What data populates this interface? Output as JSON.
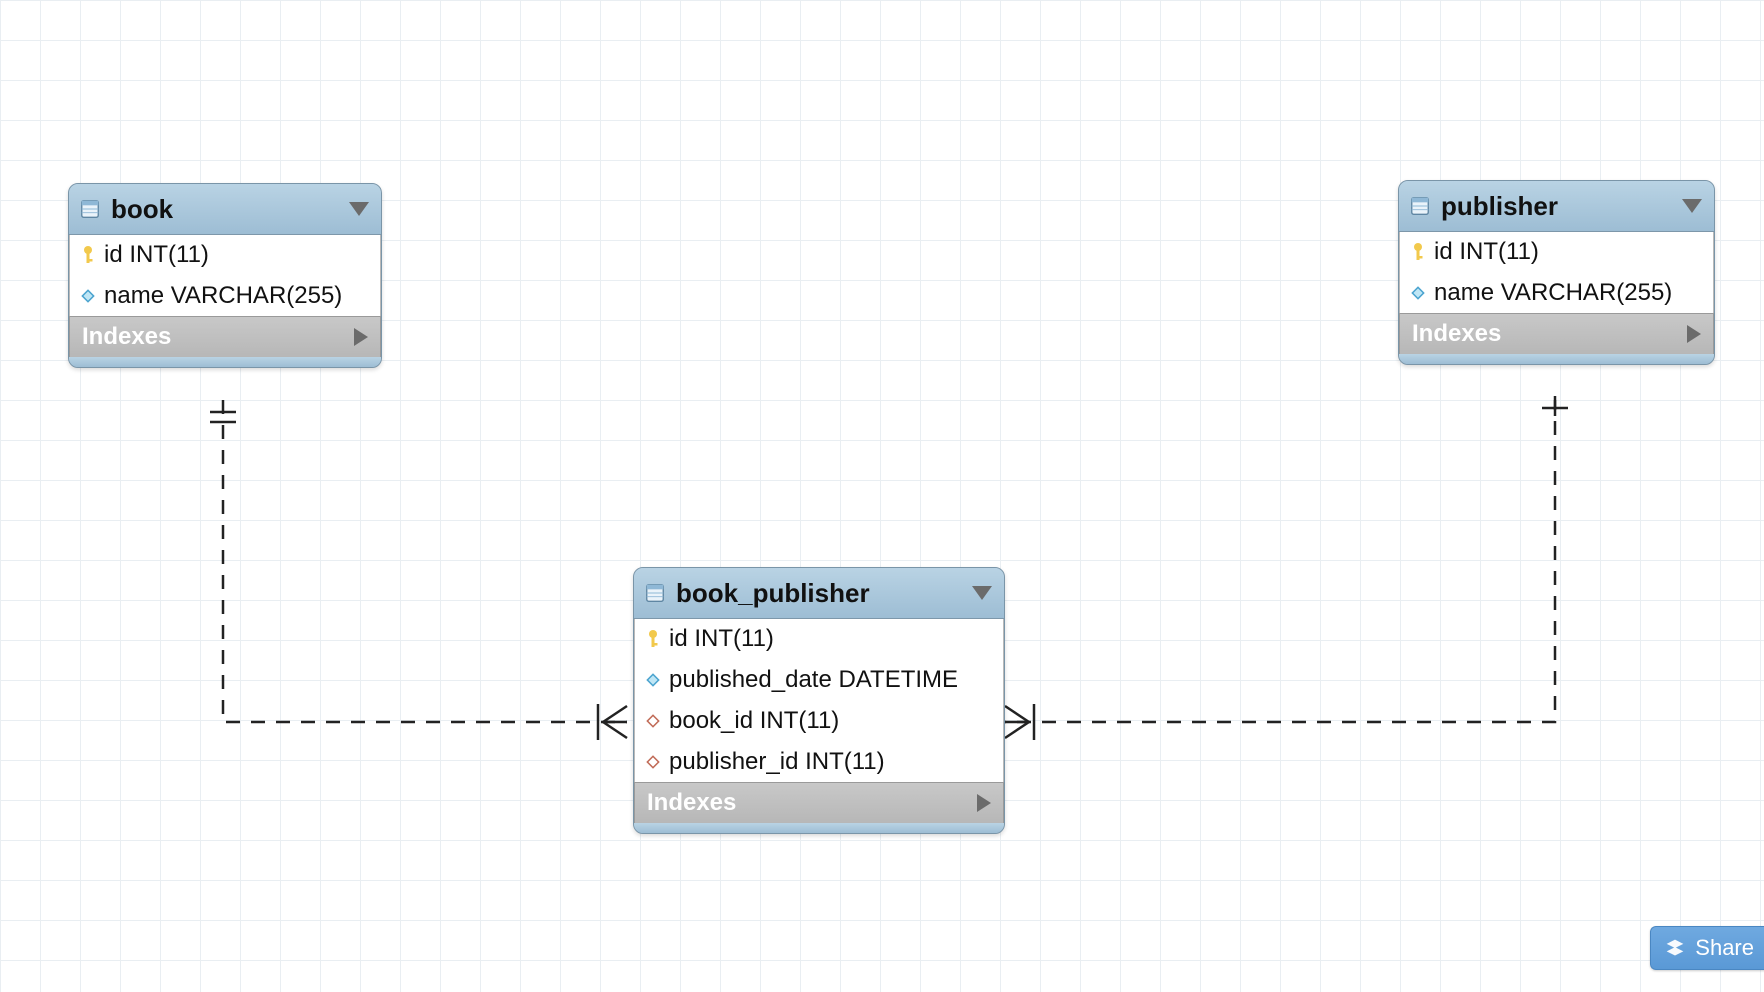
{
  "entities": {
    "book": {
      "title": "book",
      "columns": [
        {
          "icon": "key",
          "text": "id INT(11)"
        },
        {
          "icon": "diamond",
          "text": "name VARCHAR(255)"
        }
      ],
      "footer": "Indexes"
    },
    "publisher": {
      "title": "publisher",
      "columns": [
        {
          "icon": "key",
          "text": "id INT(11)"
        },
        {
          "icon": "diamond",
          "text": "name VARCHAR(255)"
        }
      ],
      "footer": "Indexes"
    },
    "book_publisher": {
      "title": "book_publisher",
      "columns": [
        {
          "icon": "key",
          "text": "id INT(11)"
        },
        {
          "icon": "diamond",
          "text": "published_date DATETIME"
        },
        {
          "icon": "diamond-open",
          "text": "book_id INT(11)"
        },
        {
          "icon": "diamond-open",
          "text": "publisher_id INT(11)"
        }
      ],
      "footer": "Indexes"
    }
  },
  "buttons": {
    "share": "Share"
  }
}
